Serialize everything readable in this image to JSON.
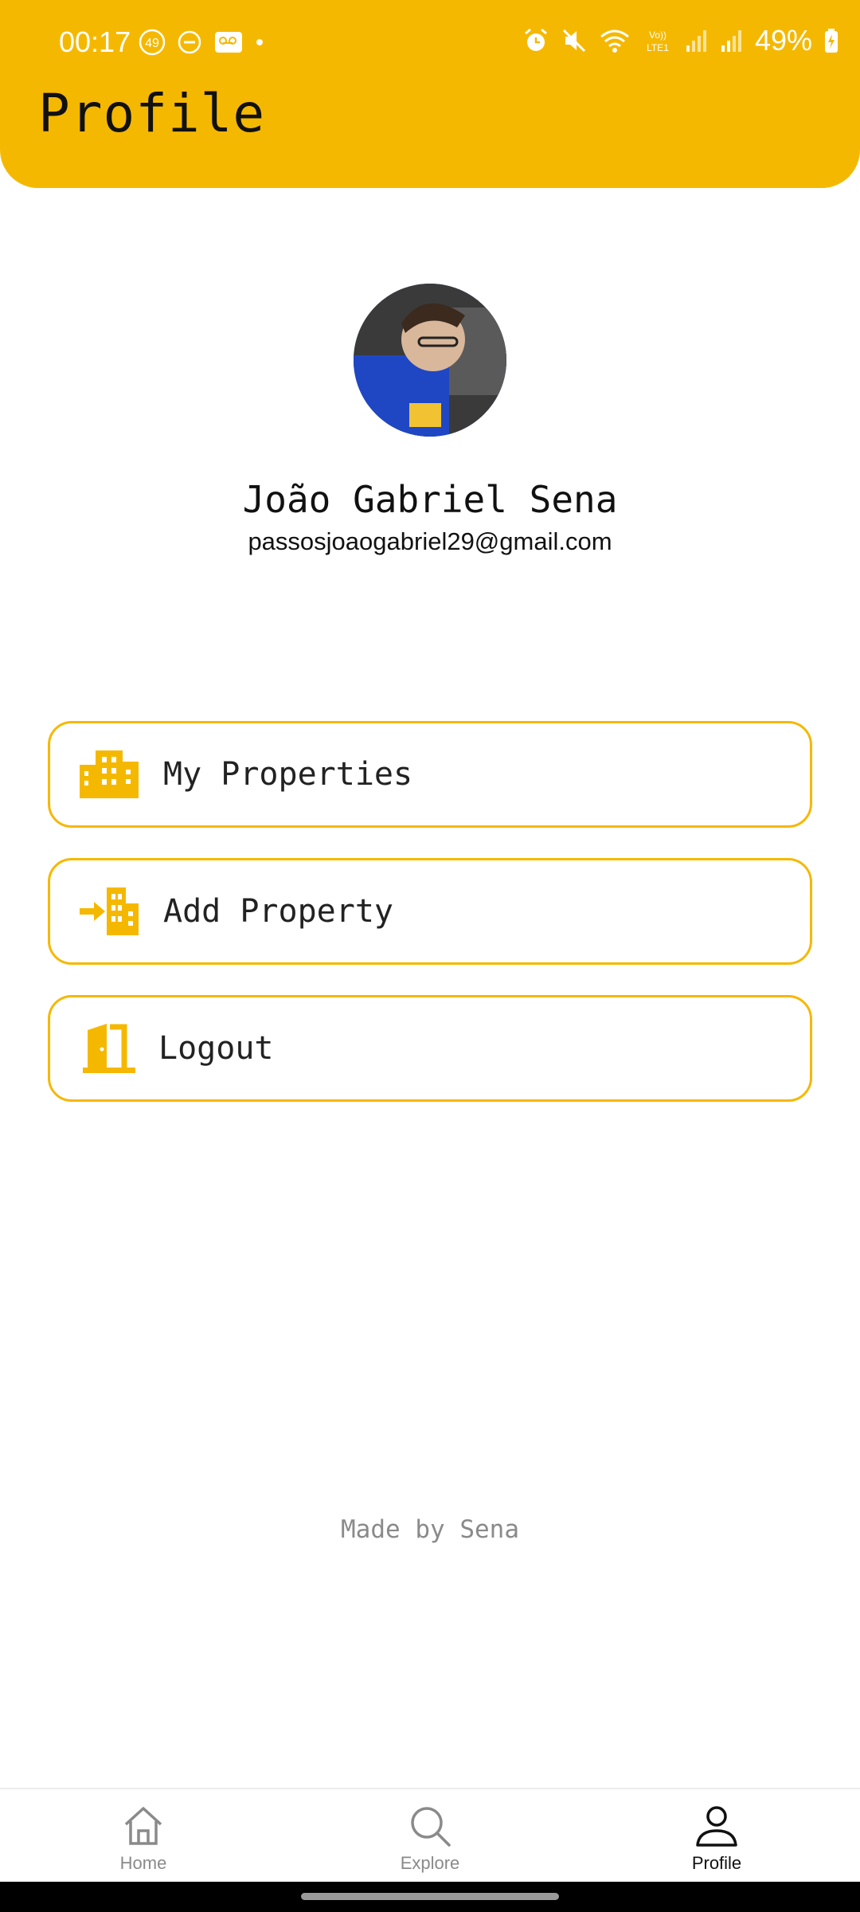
{
  "status_bar": {
    "time": "00:17",
    "notification_badge": "49",
    "battery": "49%",
    "network_label": "VoLTE LTE1"
  },
  "header": {
    "title": "Profile"
  },
  "profile": {
    "name": "João Gabriel Sena",
    "email": "passosjoaogabriel29@gmail.com"
  },
  "menu": {
    "items": [
      {
        "label": "My Properties",
        "icon": "buildings-icon"
      },
      {
        "label": "Add Property",
        "icon": "add-building-icon"
      },
      {
        "label": "Logout",
        "icon": "door-exit-icon"
      }
    ]
  },
  "footer": {
    "credit": "Made by Sena"
  },
  "bottom_nav": {
    "items": [
      {
        "label": "Home",
        "icon": "home-icon",
        "active": false
      },
      {
        "label": "Explore",
        "icon": "search-icon",
        "active": false
      },
      {
        "label": "Profile",
        "icon": "person-icon",
        "active": true
      }
    ]
  },
  "colors": {
    "accent": "#F5B800",
    "background": "#FFFFFF",
    "text": "#111111",
    "muted": "#8A8A8A"
  }
}
